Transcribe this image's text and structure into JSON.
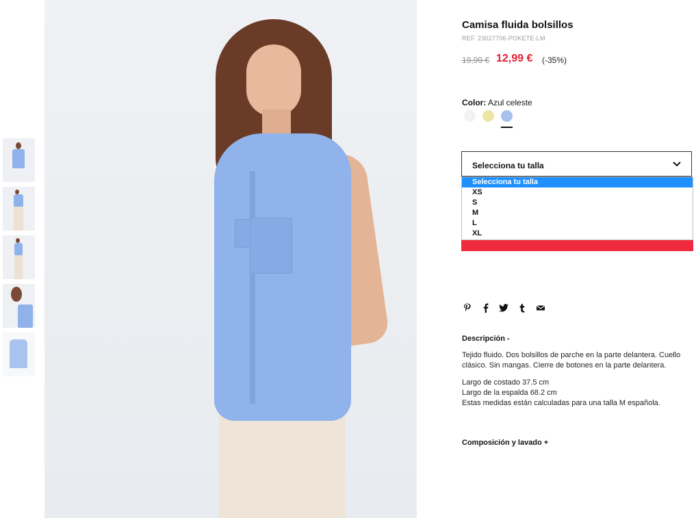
{
  "product": {
    "title": "Camisa fluida bolsillos",
    "ref": "REF. 23027706-POKETE-LM",
    "old_price": "19,99 €",
    "new_price": "12,99 €",
    "discount": "(-35%)"
  },
  "color": {
    "label": "Color:",
    "value": "Azul celeste",
    "swatches": [
      {
        "name": "blanco",
        "hex": "#f2f2f2"
      },
      {
        "name": "amarillo",
        "hex": "#ece5a3"
      },
      {
        "name": "azul celeste",
        "hex": "#a9c0ee"
      }
    ],
    "selected_index": 2
  },
  "size": {
    "select_label": "Selecciona tu talla",
    "options": [
      "Selecciona tu talla",
      "XS",
      "S",
      "M",
      "L",
      "XL"
    ],
    "highlighted_index": 0
  },
  "social": [
    "pinterest-icon",
    "facebook-icon",
    "twitter-icon",
    "tumblr-icon",
    "email-icon"
  ],
  "description": {
    "heading": "Descripción  -",
    "paragraph": "Tejido fluido. Dos bolsillos de parche en la parte delantera. Cuello clásico. Sin mangas. Cierre de botones en la parte delantera.",
    "measure_1": "Largo de costado 37.5 cm",
    "measure_2": "Largo de la espalda 68.2 cm",
    "measure_3": "Estas medidas están calculadas para una talla M española."
  },
  "composition": {
    "heading": "Composición y lavado  +"
  },
  "colors": {
    "price_red": "#e01f32",
    "button_red": "#ef2a3e",
    "option_highlight": "#1e90ff",
    "shirt_blue": "#8fb3ea"
  }
}
